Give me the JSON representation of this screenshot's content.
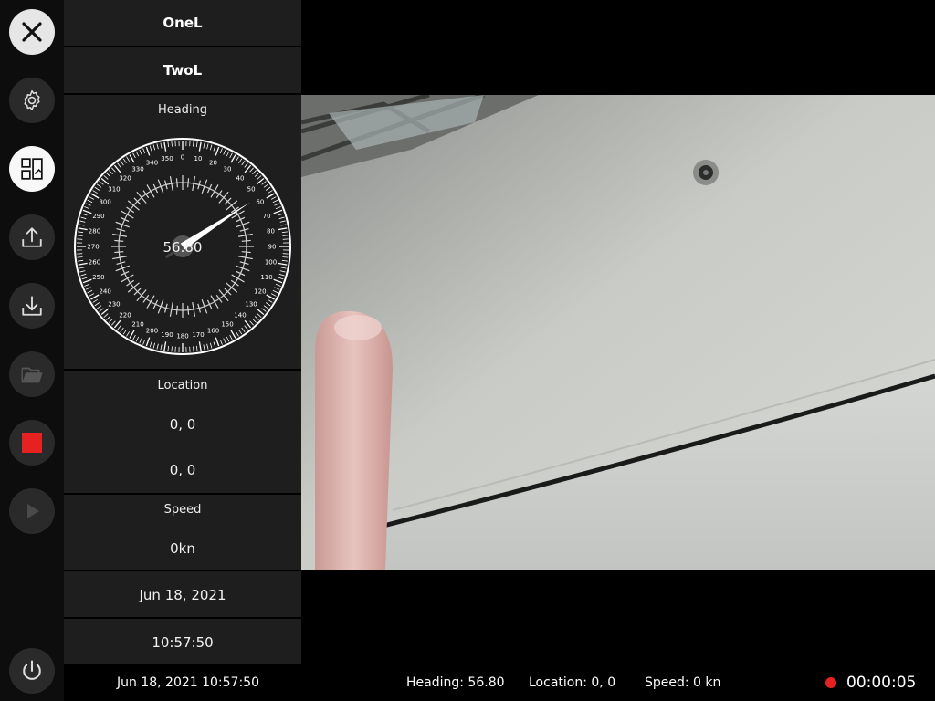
{
  "rail": {
    "buttons": [
      {
        "name": "close-icon"
      },
      {
        "name": "settings-gear-icon"
      },
      {
        "name": "layout-switch-icon"
      },
      {
        "name": "upload-icon"
      },
      {
        "name": "download-icon"
      },
      {
        "name": "open-folder-icon"
      },
      {
        "name": "stop-record-icon"
      },
      {
        "name": "play-icon"
      },
      {
        "name": "power-icon"
      }
    ]
  },
  "panel": {
    "btn_one": "OneL",
    "btn_two": "TwoL",
    "heading_label": "Heading",
    "heading_value": "56.80",
    "compass_ticks": [
      "0",
      "10",
      "20",
      "30",
      "40",
      "50",
      "60",
      "70",
      "80",
      "90",
      "100",
      "110",
      "120",
      "130",
      "140",
      "150",
      "160",
      "170",
      "180",
      "190",
      "200",
      "210",
      "220",
      "230",
      "240",
      "250",
      "260",
      "270",
      "280",
      "290",
      "300",
      "310",
      "320",
      "330",
      "340",
      "350"
    ],
    "location_label": "Location",
    "location_line1": "0, 0",
    "location_line2": "0, 0",
    "speed_label": "Speed",
    "speed_value": "0kn",
    "date": "Jun 18, 2021",
    "time": "10:57:50"
  },
  "status": {
    "datetime": "Jun 18, 2021  10:57:50",
    "heading": "Heading: 56.80",
    "location": "Location: 0, 0",
    "speed": "Speed: 0 kn",
    "rec_time": "00:00:05"
  },
  "colors": {
    "record_red": "#e52121",
    "panel_bg": "#1e1e1e"
  }
}
